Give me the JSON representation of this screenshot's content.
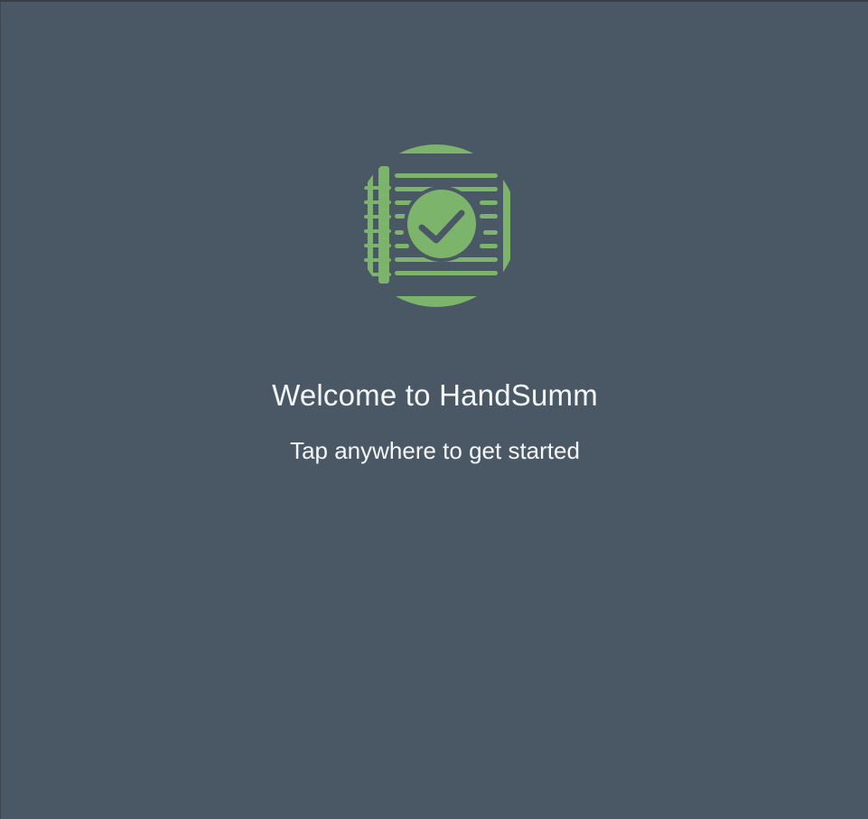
{
  "app": {
    "logo_icon": "notebook-checkmark-icon",
    "accent_color": "#7db46c",
    "background_color": "#4a5866"
  },
  "welcome": {
    "title": "Welcome to HandSumm",
    "subtitle": "Tap anywhere to get started"
  }
}
